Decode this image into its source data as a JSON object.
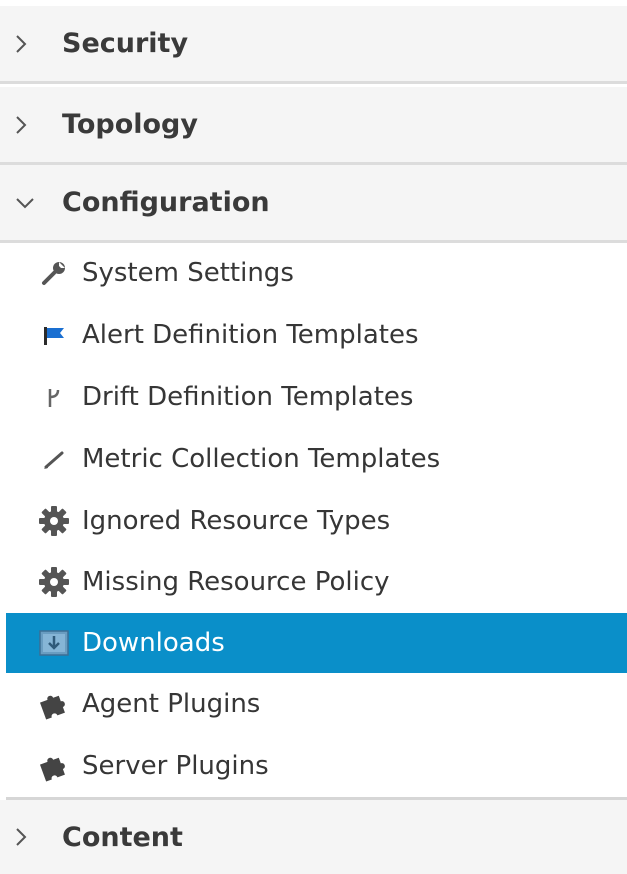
{
  "sections": {
    "security": {
      "label": "Security",
      "expanded": false
    },
    "topology": {
      "label": "Topology",
      "expanded": false
    },
    "configuration": {
      "label": "Configuration",
      "expanded": true
    },
    "content": {
      "label": "Content",
      "expanded": false
    }
  },
  "configuration_items": [
    {
      "label": "System Settings",
      "icon": "wrench-icon"
    },
    {
      "label": "Alert Definition Templates",
      "icon": "flag-icon"
    },
    {
      "label": "Drift Definition Templates",
      "icon": "branch-icon"
    },
    {
      "label": "Metric Collection Templates",
      "icon": "pencil-icon"
    },
    {
      "label": "Ignored Resource Types",
      "icon": "gear-icon"
    },
    {
      "label": "Missing Resource Policy",
      "icon": "gear-icon"
    },
    {
      "label": "Downloads",
      "icon": "download-icon",
      "selected": true
    },
    {
      "label": "Agent Plugins",
      "icon": "puzzle-icon"
    },
    {
      "label": "Server Plugins",
      "icon": "puzzle-icon"
    }
  ],
  "colors": {
    "selected_bg": "#0a8fc9",
    "header_bg": "#f5f5f5",
    "flag_blue": "#1a6fd1"
  }
}
